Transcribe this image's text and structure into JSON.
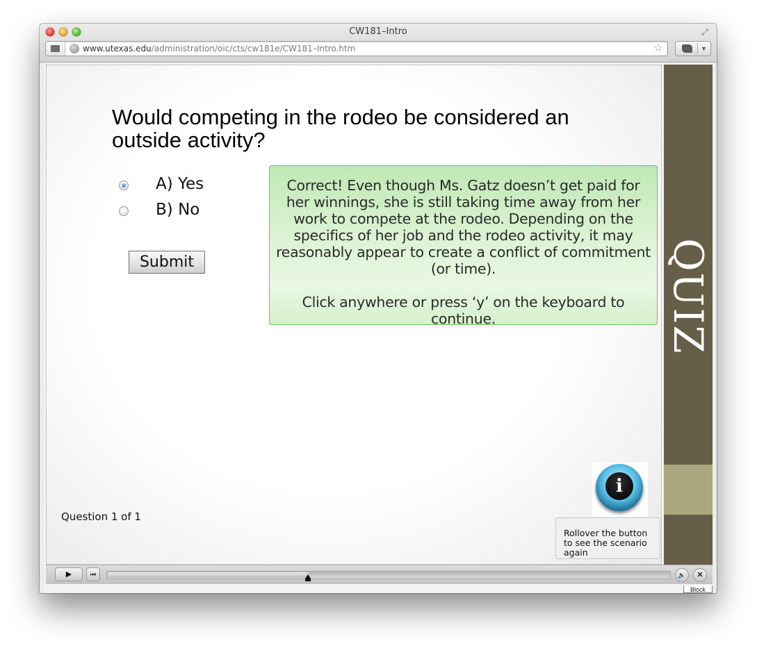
{
  "browser": {
    "window_title": "CW181–Intro",
    "url_host": "www.utexas.edu",
    "url_path": "/administration/oic/cts/cw181e/CW181–Intro.htm"
  },
  "slide": {
    "question": "Would competing in the rodeo be considered an outside activity?",
    "options": [
      {
        "label": "A) Yes",
        "selected": true
      },
      {
        "label": "B) No",
        "selected": false
      }
    ],
    "submit_label": "Submit",
    "feedback": {
      "line1": "Correct! Even though Ms. Gatz doesn’t get paid for her winnings, she is still taking time away from her work to compete at the rodeo. Depending on the specifics of her job and the rodeo activity, it may reasonably appear to create a conflict of commitment (or time).",
      "line2": "Click anywhere or press ‘y’ on the keyboard to continue."
    },
    "question_count": "Question 1 of 1",
    "tooltip": "Rollover the button to see the scenario again",
    "side_label": "QUIZ"
  },
  "player": {
    "progress": 0.356,
    "block_label": "Block"
  },
  "colors": {
    "side_panel": "#665e48",
    "side_band": "#aba77e",
    "feedback_bg": "#dcf3d4"
  }
}
